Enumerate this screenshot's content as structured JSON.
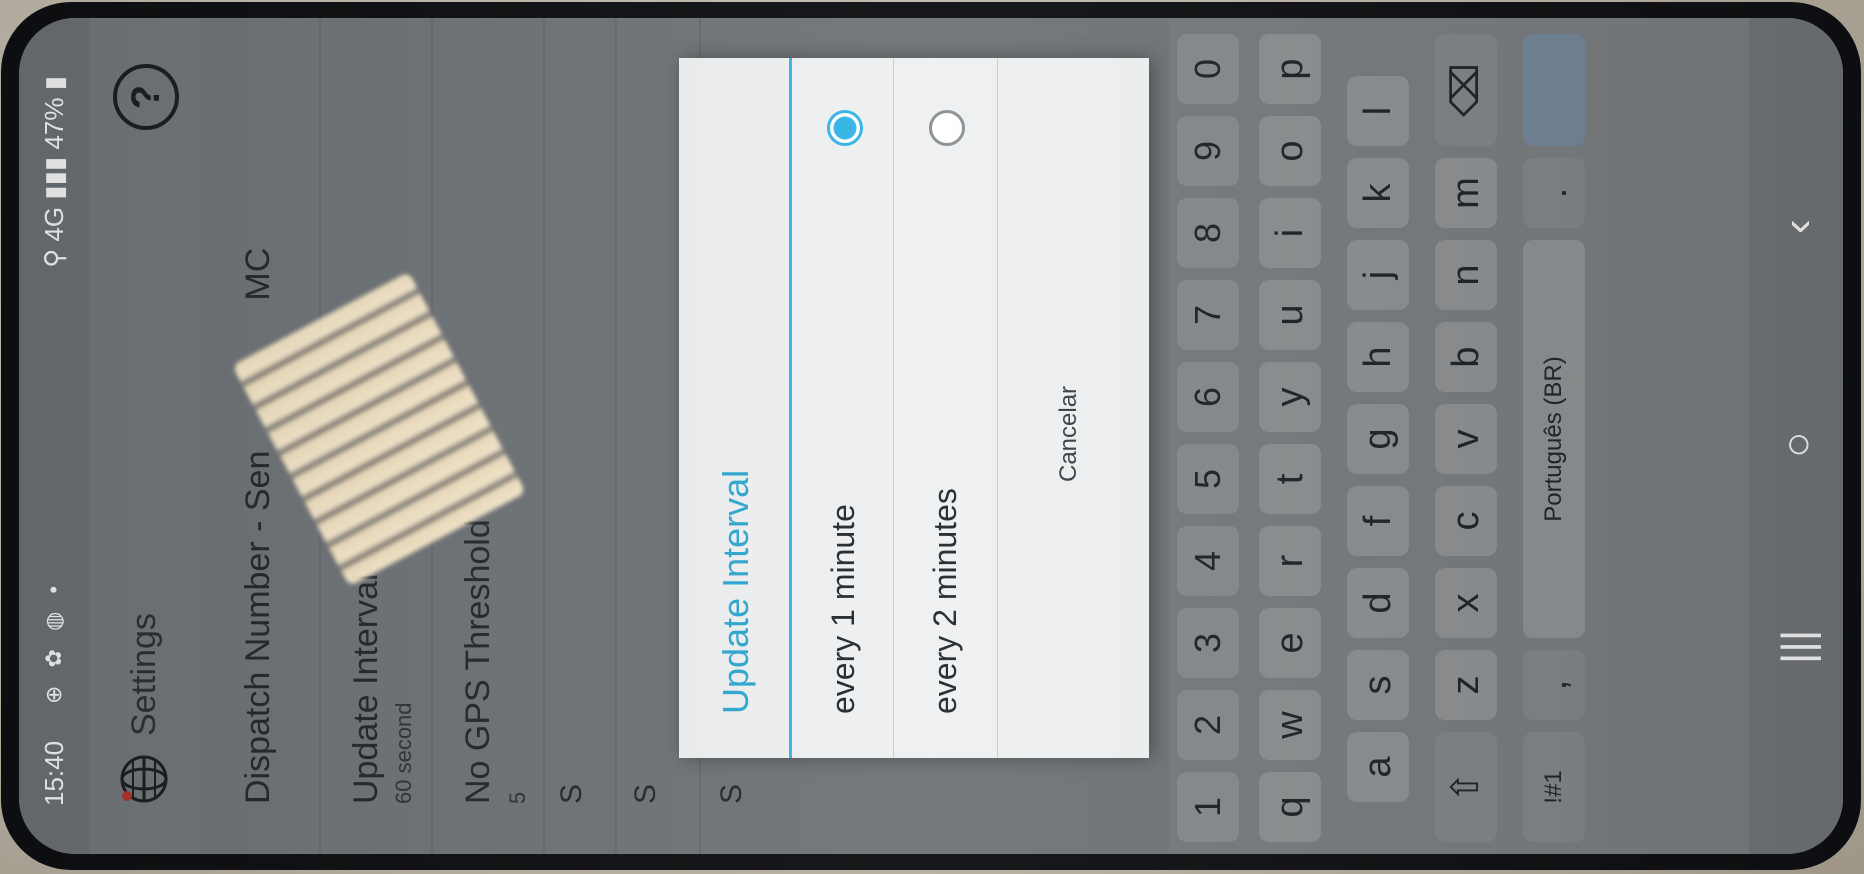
{
  "status": {
    "time": "15:40",
    "icons": "⊕ ✿ ◍ •",
    "right": "⚲ 4G ▮▮▮ 47% ▮"
  },
  "appbar": {
    "title": "Settings",
    "help": "?"
  },
  "settings": {
    "dispatch_label": "Dispatch Number - Sen",
    "dispatch_suffix": "MC",
    "update_label": "Update Interval",
    "update_sub": "60 second",
    "nogps_label": "No GPS Threshold",
    "nogps_sub": "5",
    "partials": [
      "S",
      "S",
      "S"
    ]
  },
  "dialog": {
    "title": "Update Interval",
    "options": [
      {
        "label": "every 1 minute",
        "selected": true
      },
      {
        "label": "every 2 minutes",
        "selected": false
      }
    ],
    "cancel": "Cancelar"
  },
  "keyboard": {
    "numbers": [
      "1",
      "2",
      "3",
      "4",
      "5",
      "6",
      "7",
      "8",
      "9",
      "0"
    ],
    "row1": [
      "q",
      "w",
      "e",
      "r",
      "t",
      "y",
      "u",
      "i",
      "o",
      "p"
    ],
    "row2": [
      "a",
      "s",
      "d",
      "f",
      "g",
      "h",
      "j",
      "k",
      "l"
    ],
    "row3": [
      "z",
      "x",
      "c",
      "v",
      "b",
      "n",
      "m"
    ],
    "shift": "⇧",
    "backspace": "⌫",
    "symbols": "!#1",
    "comma": ",",
    "space": "Português (BR)",
    "period": ".",
    "enter": "›"
  },
  "nav": {
    "recents": "|||",
    "home": "○",
    "back": "‹"
  },
  "colors": {
    "accent": "#33b5e5",
    "title": "#2ea7d0",
    "overlay": "#6f7478",
    "dialog_bg": "#eef0f1"
  }
}
